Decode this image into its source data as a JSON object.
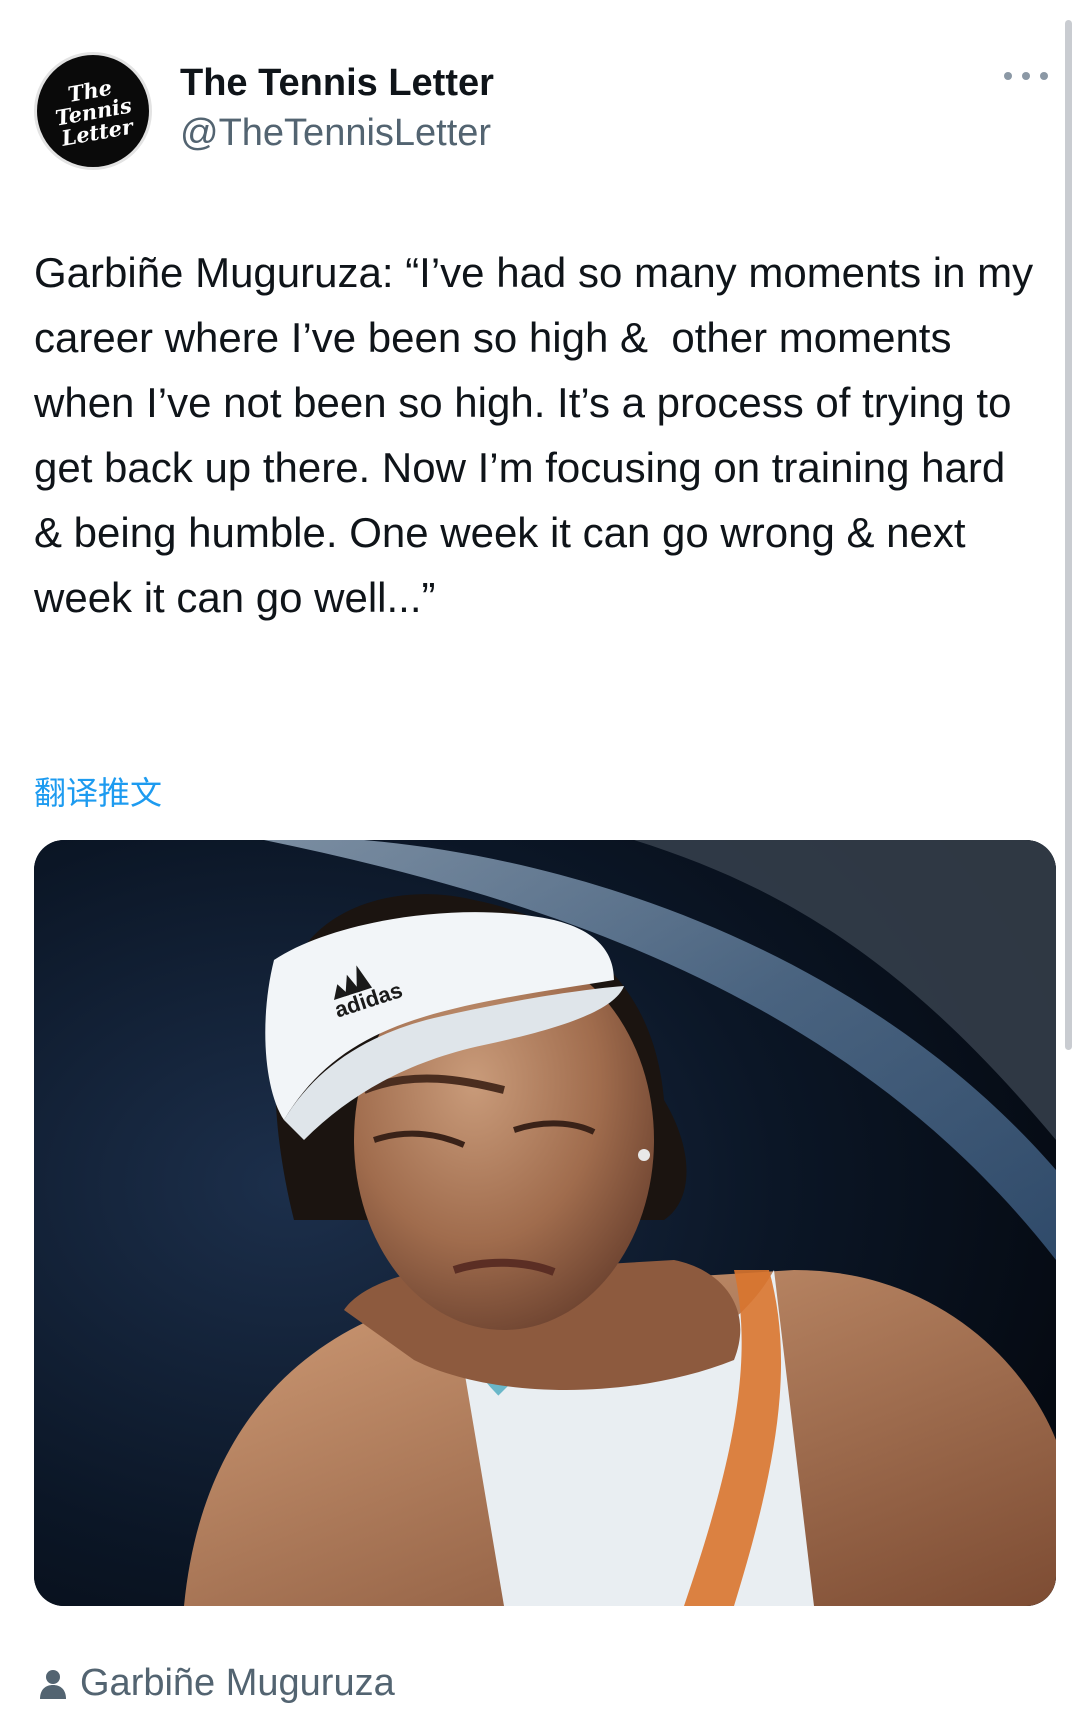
{
  "account": {
    "display_name": "The Tennis Letter",
    "handle": "@TheTennisLetter",
    "avatar_logo": [
      "The",
      "Tennis",
      "Letter"
    ]
  },
  "tweet": {
    "text": "Garbiñe Muguruza: “I’ve had so many moments in my career where I’ve been so high &  other moments when I’ve not been so high. It’s a process of trying to get back up there. Now I’m focusing on training hard & being humble. One week it can go wrong & next week it can go well...”",
    "translate_label": "翻译推文"
  },
  "photo": {
    "visor_brand": "adidas"
  },
  "tagged_user": {
    "name": "Garbiñe Muguruza",
    "icon": "person-icon"
  },
  "colors": {
    "link_blue": "#1d9bf0",
    "secondary_text": "#536471",
    "primary_text": "#0f1419"
  },
  "icons": {
    "more": "more-horizontal-icon",
    "tag": "person-icon"
  }
}
